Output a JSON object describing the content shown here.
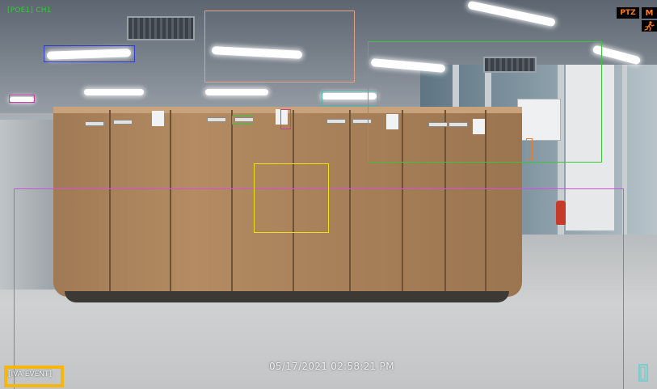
{
  "overlay": {
    "channel_label": "[POE1] CH1",
    "ptz_badge": "PTZ",
    "record_badge": "M",
    "motion_badge_icon": "running-person-icon",
    "timestamp": "05/17/2021 02:58:21 PM",
    "event_label": "[IVA EVENT]",
    "corner_icon": "doorway-icon"
  },
  "colors": {
    "channel_label": "#2ed12e",
    "badge_text": "#ff7a1a",
    "event_frame": "#f7b60d",
    "iva_zone": "#d24fe0",
    "box_blue": "#2f3ecf",
    "box_peach": "#e1a18b",
    "box_green": "#3ac53a",
    "box_yellow": "#f0e01c",
    "box_teal": "#4fb3a6",
    "box_magenta": "#c93f9e",
    "box_orange": "#e77d2a"
  }
}
